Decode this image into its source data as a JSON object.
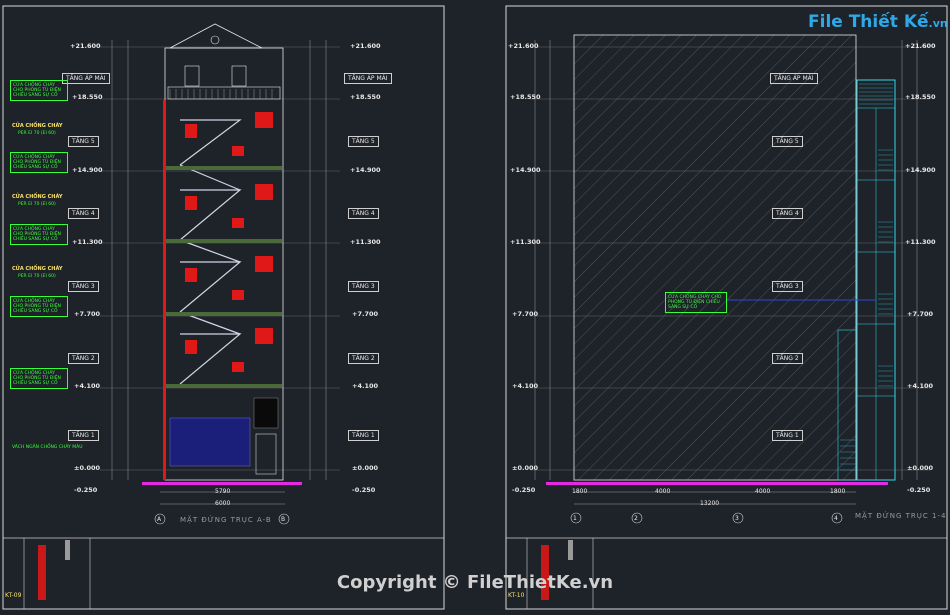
{
  "brand": {
    "name": "File Thiết Kế",
    "suffix": ".vn"
  },
  "copyright": "Copyright © FileThietKe.vn",
  "left_view": {
    "title": "MẶT ĐỨNG TRỤC A-B",
    "axes": [
      "A",
      "B"
    ],
    "dim_bottom": "6000",
    "dim_bottom_inner": "5790",
    "elevations_left": [
      "+21.600",
      "+18.550",
      "+14.900",
      "+11.300",
      "+7.700",
      "+4.100",
      "±0.000",
      "-0.250"
    ],
    "elevations_right": [
      "+21.600",
      "+18.550",
      "+14.900",
      "+11.300",
      "+7.700",
      "+4.100",
      "±0.000",
      "-0.250"
    ],
    "floor_tags": [
      "TẦNG ÁP MÁI",
      "TẦNG 5",
      "TẦNG 4",
      "TẦNG 3",
      "TẦNG 2",
      "TẦNG 1"
    ],
    "fire_door_label": "CỬA CHỐNG CHÁY",
    "fire_door_sub": "PER EI 70 (EI 60)",
    "green_note": "CỬA CHỐNG CHÁY CHO PHÒNG TỦ ĐIỆN CHIẾU SÁNG SỰ CỐ",
    "bottom_note": "VÁCH NGĂN CHỐNG CHÁY MÀU"
  },
  "right_view": {
    "title": "MẶT ĐỨNG TRỤC 1-4",
    "axes": [
      "1",
      "2",
      "3",
      "4"
    ],
    "dim_bottom": "13200",
    "dims_segments": [
      "1800",
      "4000",
      "4000",
      "1800"
    ],
    "elevations_left": [
      "+21.600",
      "+18.550",
      "+14.900",
      "+11.300",
      "+7.700",
      "+4.100",
      "±0.000",
      "-0.250"
    ],
    "elevations_right": [
      "+21.600",
      "+18.550",
      "+14.900",
      "+11.300",
      "+7.700",
      "+4.100",
      "±0.000",
      "-0.250"
    ],
    "floor_tags": [
      "TẦNG ÁP MÁI",
      "TẦNG 5",
      "TẦNG 4",
      "TẦNG 3",
      "TẦNG 2",
      "TẦNG 1"
    ],
    "green_note": "CỬA CHỐNG CHÁY CHO PHÒNG TỦ ĐIỆN CHIẾU SÁNG SỰ CỐ"
  },
  "sheet_codes": {
    "left": "KT-09",
    "right": "KT-10"
  }
}
